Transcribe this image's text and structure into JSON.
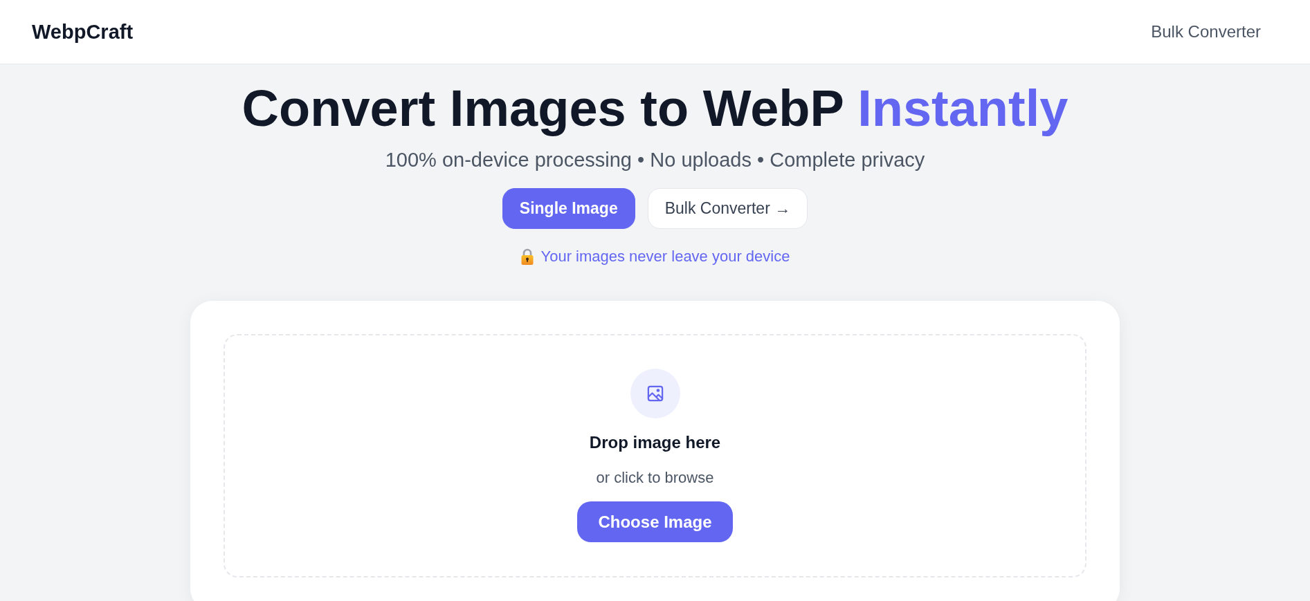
{
  "header": {
    "logo": "WebpCraft",
    "nav_links": [
      {
        "label": "Bulk Converter"
      }
    ]
  },
  "hero": {
    "title": "Convert Images to WebP",
    "title_highlight": "Instantly",
    "subtitle": "100% on-device processing • No uploads • Complete privacy"
  },
  "mode_tabs": [
    {
      "label": "Single Image",
      "selected": true
    },
    {
      "label": "Bulk Converter →",
      "selected": false
    }
  ],
  "privacy_note": "Your images never leave your device",
  "dropzone": {
    "heading": "Drop image here",
    "hint": "or click to browse",
    "button": "Choose Image"
  }
}
